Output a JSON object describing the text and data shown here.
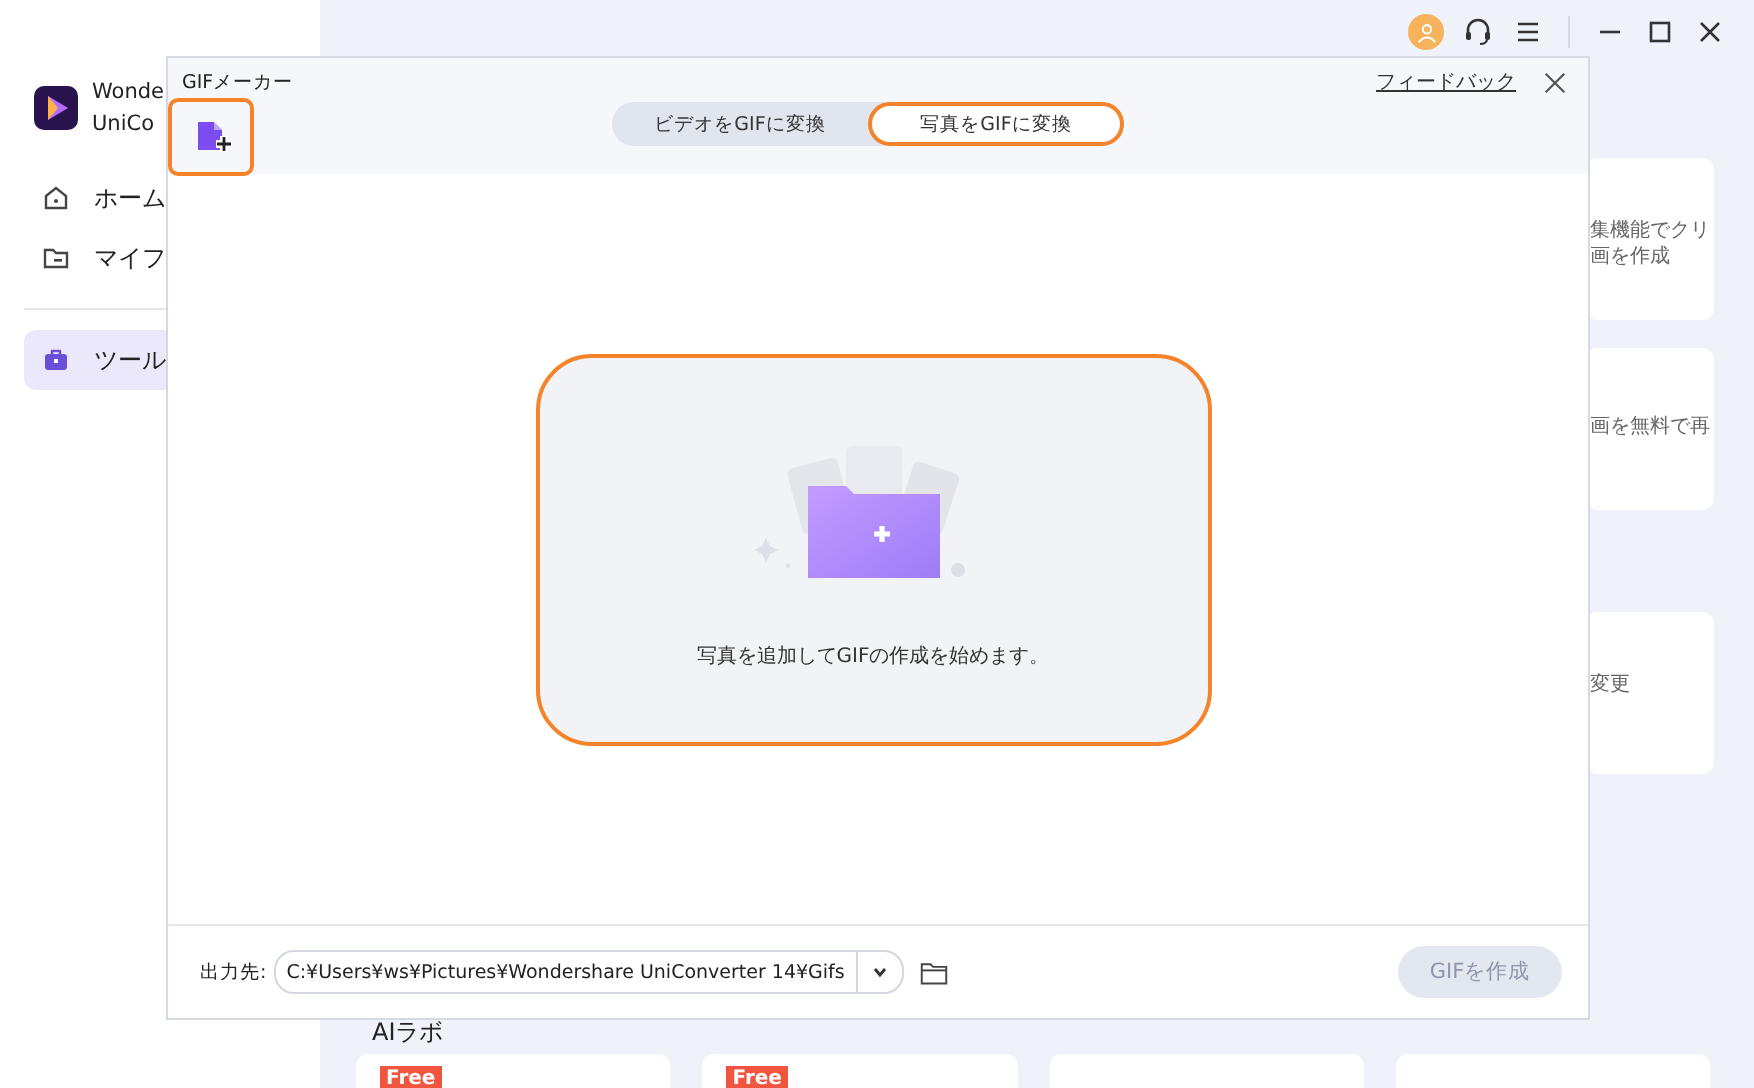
{
  "app": {
    "brand_lines": [
      "Wonde",
      "UniCo"
    ],
    "sidebar": {
      "items": [
        {
          "label": "ホーム",
          "kind": "home",
          "selected": false
        },
        {
          "label": "マイフ",
          "kind": "folder",
          "selected": false
        },
        {
          "label": "ツール",
          "kind": "toolbox",
          "selected": true
        }
      ]
    },
    "cards": [
      {
        "lines": [
          "集機能でクリ",
          "画を作成"
        ]
      },
      {
        "lines": [
          "画を無料で再"
        ]
      },
      {
        "lines": [
          "変更"
        ]
      }
    ],
    "section_heading": "AIラボ",
    "bottom_cards": [
      {
        "kind": "free",
        "badge": "Free"
      },
      {
        "kind": "free",
        "badge": "Free"
      },
      {
        "kind": "plain"
      },
      {
        "kind": "plain"
      }
    ]
  },
  "dialog": {
    "title": "GIFメーカー",
    "add_button": {
      "highlighted": true
    },
    "feedback_link": "フィードバック",
    "tabs": [
      {
        "label": "ビデオをGIFに変換",
        "selected": false,
        "highlighted": false
      },
      {
        "label": "写真をGIFに変換",
        "selected": true,
        "highlighted": true
      }
    ],
    "drop_zone": {
      "text": "写真を追加してGIFの作成を始めます。",
      "highlighted": true
    },
    "output": {
      "label": "出力先:",
      "path": "C:¥Users¥ws¥Pictures¥Wondershare UniConverter 14¥Gifs"
    },
    "create_button": {
      "label": "GIFを作成",
      "disabled": true
    }
  }
}
